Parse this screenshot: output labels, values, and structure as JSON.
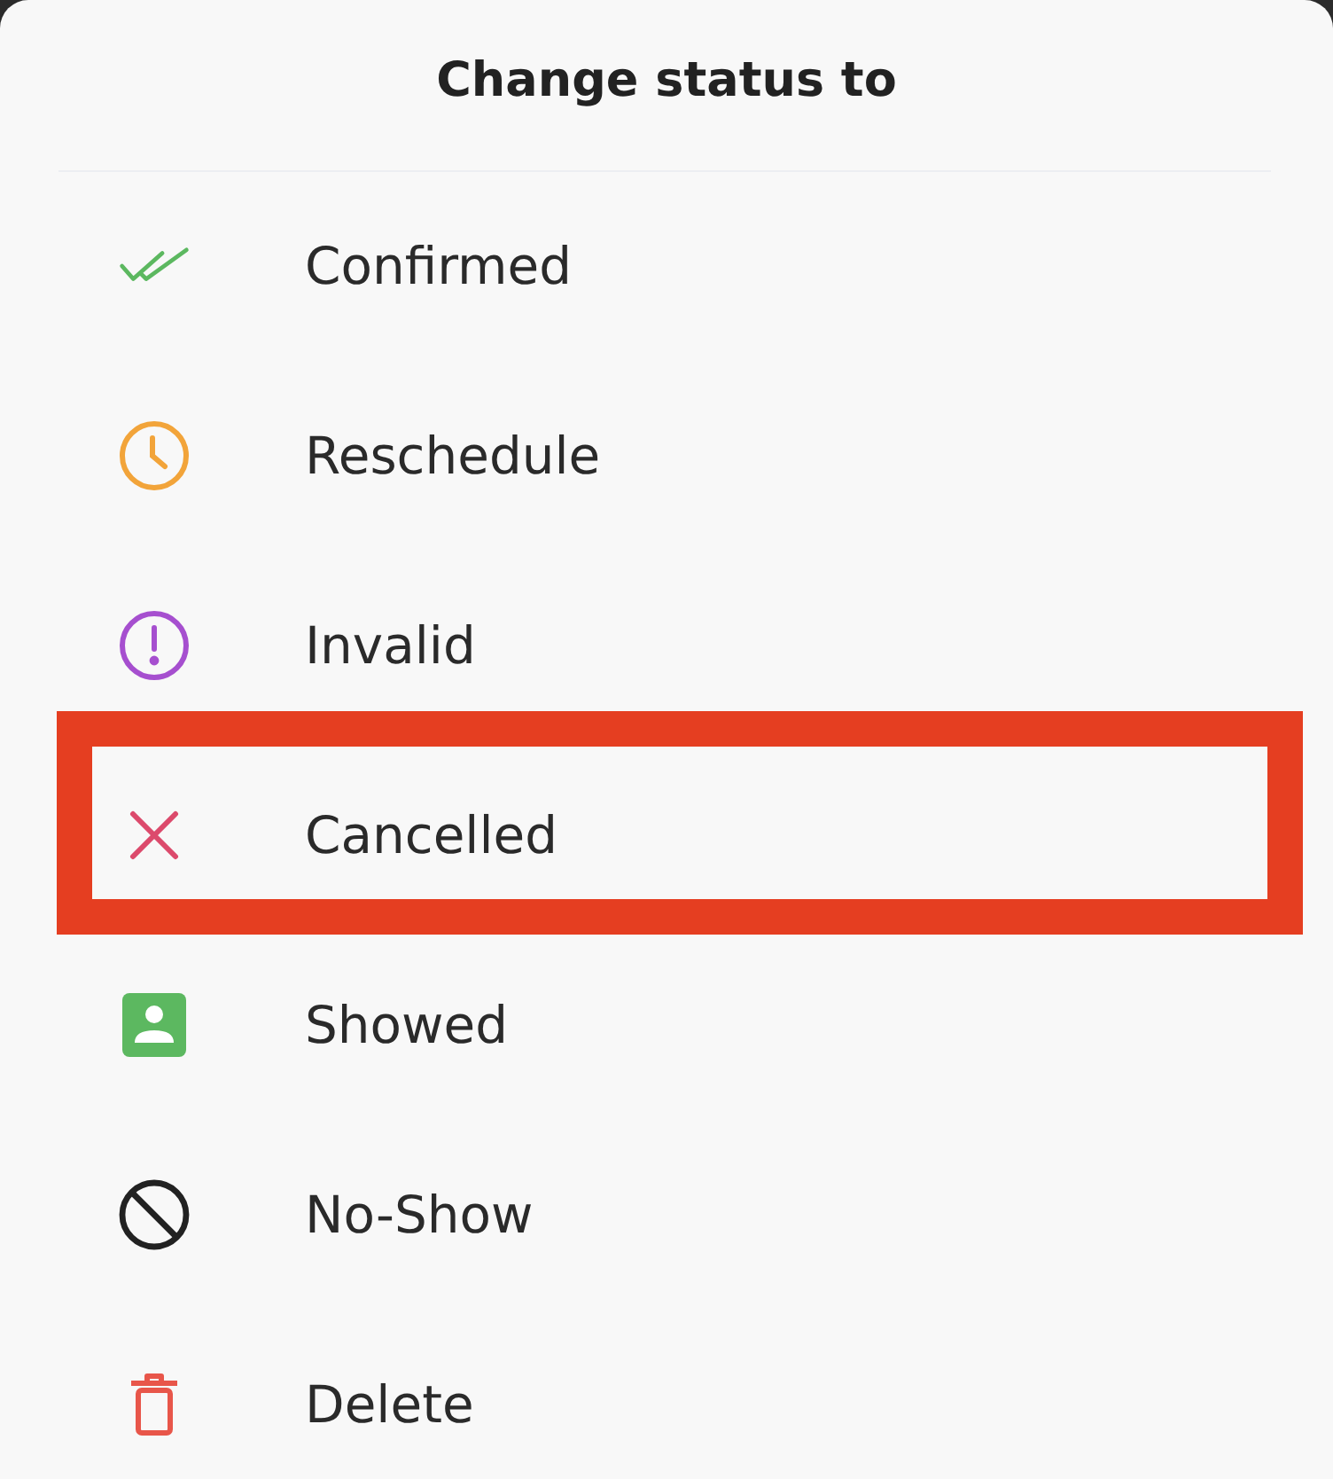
{
  "title": "Change status to",
  "items": [
    {
      "kind": "confirm",
      "label": "Confirmed",
      "color": "#5cb860",
      "highlighted": false
    },
    {
      "kind": "reschedule",
      "label": "Reschedule",
      "color": "#f2a43a",
      "highlighted": false
    },
    {
      "kind": "invalid",
      "label": "Invalid",
      "color": "#a64fcf",
      "highlighted": false
    },
    {
      "kind": "cancel",
      "label": "Cancelled",
      "color": "#dc4a6c",
      "highlighted": true
    },
    {
      "kind": "showed",
      "label": "Showed",
      "color": "#5cb860",
      "highlighted": false
    },
    {
      "kind": "noshow",
      "label": "No-Show",
      "color": "#222222",
      "highlighted": false
    },
    {
      "kind": "delete",
      "label": "Delete",
      "color": "#e8564a",
      "highlighted": false
    }
  ]
}
